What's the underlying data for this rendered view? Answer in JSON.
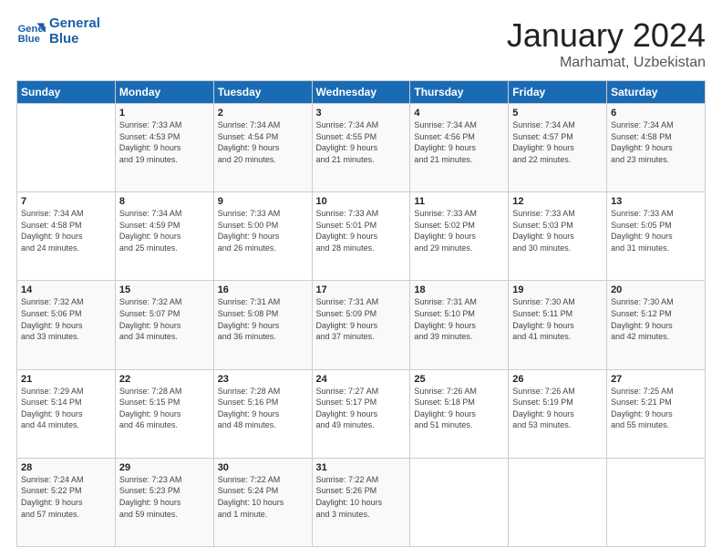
{
  "header": {
    "logo_line1": "General",
    "logo_line2": "Blue",
    "month_title": "January 2024",
    "location": "Marhamat, Uzbekistan"
  },
  "days_of_week": [
    "Sunday",
    "Monday",
    "Tuesday",
    "Wednesday",
    "Thursday",
    "Friday",
    "Saturday"
  ],
  "weeks": [
    [
      {
        "day": "",
        "info": ""
      },
      {
        "day": "1",
        "info": "Sunrise: 7:33 AM\nSunset: 4:53 PM\nDaylight: 9 hours\nand 19 minutes."
      },
      {
        "day": "2",
        "info": "Sunrise: 7:34 AM\nSunset: 4:54 PM\nDaylight: 9 hours\nand 20 minutes."
      },
      {
        "day": "3",
        "info": "Sunrise: 7:34 AM\nSunset: 4:55 PM\nDaylight: 9 hours\nand 21 minutes."
      },
      {
        "day": "4",
        "info": "Sunrise: 7:34 AM\nSunset: 4:56 PM\nDaylight: 9 hours\nand 21 minutes."
      },
      {
        "day": "5",
        "info": "Sunrise: 7:34 AM\nSunset: 4:57 PM\nDaylight: 9 hours\nand 22 minutes."
      },
      {
        "day": "6",
        "info": "Sunrise: 7:34 AM\nSunset: 4:58 PM\nDaylight: 9 hours\nand 23 minutes."
      }
    ],
    [
      {
        "day": "7",
        "info": "Sunrise: 7:34 AM\nSunset: 4:58 PM\nDaylight: 9 hours\nand 24 minutes."
      },
      {
        "day": "8",
        "info": "Sunrise: 7:34 AM\nSunset: 4:59 PM\nDaylight: 9 hours\nand 25 minutes."
      },
      {
        "day": "9",
        "info": "Sunrise: 7:33 AM\nSunset: 5:00 PM\nDaylight: 9 hours\nand 26 minutes."
      },
      {
        "day": "10",
        "info": "Sunrise: 7:33 AM\nSunset: 5:01 PM\nDaylight: 9 hours\nand 28 minutes."
      },
      {
        "day": "11",
        "info": "Sunrise: 7:33 AM\nSunset: 5:02 PM\nDaylight: 9 hours\nand 29 minutes."
      },
      {
        "day": "12",
        "info": "Sunrise: 7:33 AM\nSunset: 5:03 PM\nDaylight: 9 hours\nand 30 minutes."
      },
      {
        "day": "13",
        "info": "Sunrise: 7:33 AM\nSunset: 5:05 PM\nDaylight: 9 hours\nand 31 minutes."
      }
    ],
    [
      {
        "day": "14",
        "info": "Sunrise: 7:32 AM\nSunset: 5:06 PM\nDaylight: 9 hours\nand 33 minutes."
      },
      {
        "day": "15",
        "info": "Sunrise: 7:32 AM\nSunset: 5:07 PM\nDaylight: 9 hours\nand 34 minutes."
      },
      {
        "day": "16",
        "info": "Sunrise: 7:31 AM\nSunset: 5:08 PM\nDaylight: 9 hours\nand 36 minutes."
      },
      {
        "day": "17",
        "info": "Sunrise: 7:31 AM\nSunset: 5:09 PM\nDaylight: 9 hours\nand 37 minutes."
      },
      {
        "day": "18",
        "info": "Sunrise: 7:31 AM\nSunset: 5:10 PM\nDaylight: 9 hours\nand 39 minutes."
      },
      {
        "day": "19",
        "info": "Sunrise: 7:30 AM\nSunset: 5:11 PM\nDaylight: 9 hours\nand 41 minutes."
      },
      {
        "day": "20",
        "info": "Sunrise: 7:30 AM\nSunset: 5:12 PM\nDaylight: 9 hours\nand 42 minutes."
      }
    ],
    [
      {
        "day": "21",
        "info": "Sunrise: 7:29 AM\nSunset: 5:14 PM\nDaylight: 9 hours\nand 44 minutes."
      },
      {
        "day": "22",
        "info": "Sunrise: 7:28 AM\nSunset: 5:15 PM\nDaylight: 9 hours\nand 46 minutes."
      },
      {
        "day": "23",
        "info": "Sunrise: 7:28 AM\nSunset: 5:16 PM\nDaylight: 9 hours\nand 48 minutes."
      },
      {
        "day": "24",
        "info": "Sunrise: 7:27 AM\nSunset: 5:17 PM\nDaylight: 9 hours\nand 49 minutes."
      },
      {
        "day": "25",
        "info": "Sunrise: 7:26 AM\nSunset: 5:18 PM\nDaylight: 9 hours\nand 51 minutes."
      },
      {
        "day": "26",
        "info": "Sunrise: 7:26 AM\nSunset: 5:19 PM\nDaylight: 9 hours\nand 53 minutes."
      },
      {
        "day": "27",
        "info": "Sunrise: 7:25 AM\nSunset: 5:21 PM\nDaylight: 9 hours\nand 55 minutes."
      }
    ],
    [
      {
        "day": "28",
        "info": "Sunrise: 7:24 AM\nSunset: 5:22 PM\nDaylight: 9 hours\nand 57 minutes."
      },
      {
        "day": "29",
        "info": "Sunrise: 7:23 AM\nSunset: 5:23 PM\nDaylight: 9 hours\nand 59 minutes."
      },
      {
        "day": "30",
        "info": "Sunrise: 7:22 AM\nSunset: 5:24 PM\nDaylight: 10 hours\nand 1 minute."
      },
      {
        "day": "31",
        "info": "Sunrise: 7:22 AM\nSunset: 5:26 PM\nDaylight: 10 hours\nand 3 minutes."
      },
      {
        "day": "",
        "info": ""
      },
      {
        "day": "",
        "info": ""
      },
      {
        "day": "",
        "info": ""
      }
    ]
  ]
}
